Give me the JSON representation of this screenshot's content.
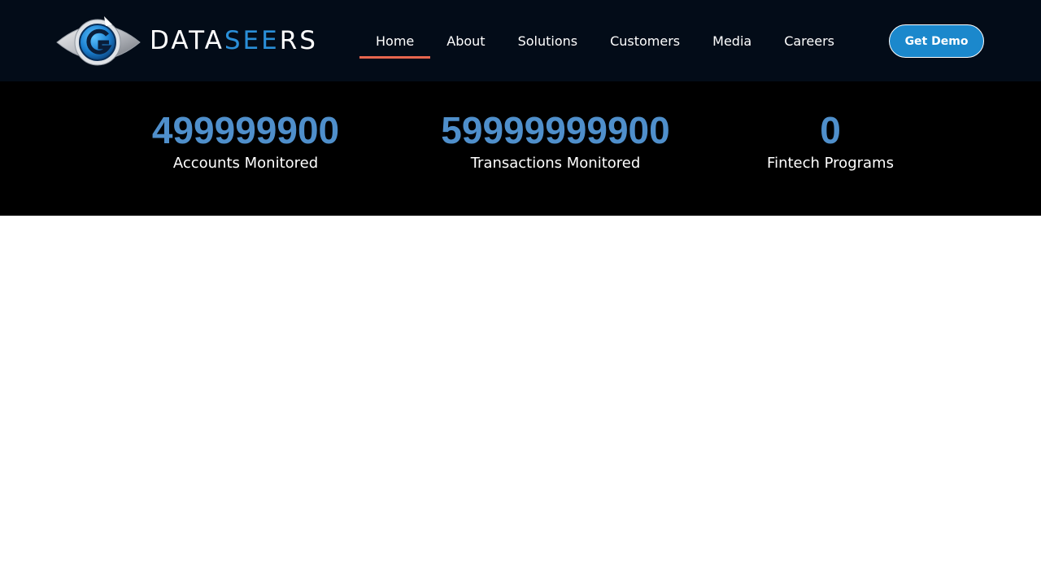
{
  "brand": {
    "name_prefix": "DATA",
    "name_accent": "SEE",
    "name_suffix": "RS",
    "logo_icon": "eye-g-logo-icon",
    "accent_color": "#2a8fd8"
  },
  "nav": {
    "items": [
      {
        "label": "Home",
        "active": true
      },
      {
        "label": "About",
        "active": false
      },
      {
        "label": "Solutions",
        "active": false
      },
      {
        "label": "Customers",
        "active": false
      },
      {
        "label": "Media",
        "active": false
      },
      {
        "label": "Careers",
        "active": false
      }
    ],
    "active_underline_color": "#e8664e"
  },
  "cta": {
    "label": "Get Demo",
    "color": "#1b88cc"
  },
  "stats": [
    {
      "value": "499999900",
      "label": "Accounts Monitored"
    },
    {
      "value": "59999999900",
      "label": "Transactions Monitored"
    },
    {
      "value": "0",
      "label": "Fintech Programs"
    }
  ],
  "colors": {
    "header_bg": "#030c18",
    "stats_bg": "#000000",
    "stat_value": "#4f8fcb"
  }
}
